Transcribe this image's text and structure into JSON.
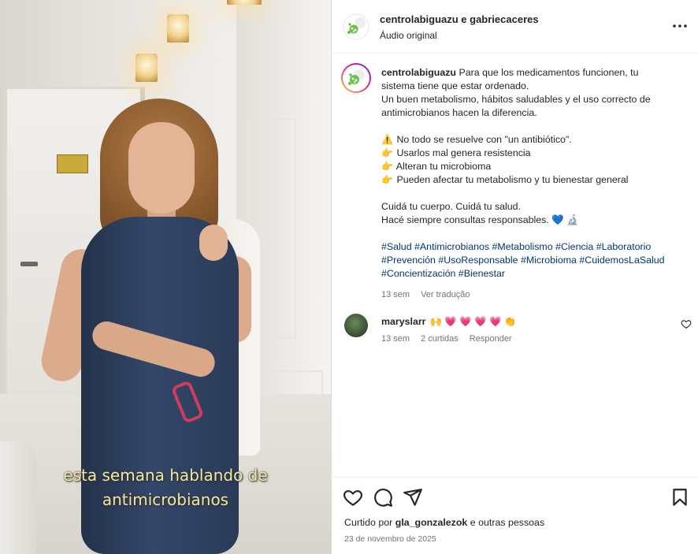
{
  "video": {
    "caption_line1": "esta semana hablando de",
    "caption_line2": "antimicrobianos"
  },
  "header": {
    "accounts": "centrolabiguazu e gabriecaceres",
    "audio": "Áudio original",
    "more_icon": "more-horizontal-icon"
  },
  "post": {
    "username": "centrolabiguazu",
    "lines": [
      "Para que los medicamentos funcionen, tu",
      "sistema tiene que estar ordenado.",
      "Un buen metabolismo, hábitos saludables y el uso correcto de",
      "antimicrobianos hacen la diferencia."
    ],
    "bullets": [
      {
        "emoji": "⚠️",
        "text": "No todo se resuelve con \"un antibiótico\"."
      },
      {
        "emoji": "👉",
        "text": "Usarlos mal genera resistencia"
      },
      {
        "emoji": "👉",
        "text": "Alteran tu microbioma"
      },
      {
        "emoji": "👉",
        "text": "Pueden afectar tu metabolismo y tu bienestar general"
      }
    ],
    "closing1": "Cuidá tu cuerpo. Cuidá tu salud.",
    "closing2": "Hacé siempre consultas responsables. 💙 🔬",
    "hashtags1": "#Salud #Antimicrobianos #Metabolismo #Ciencia #Laboratorio",
    "hashtags2": "#Prevención #UsoResponsable #Microbioma #CuidemosLaSalud",
    "hashtags3": "#Concientización #Bienestar",
    "time": "13 sem",
    "translate": "Ver tradução"
  },
  "comment": {
    "username": "maryslarr",
    "text": "🙌 💗 💗 💗 💗 👏",
    "time": "13 sem",
    "likes": "2 curtidas",
    "reply": "Responder"
  },
  "actions": {
    "liked_prefix": "Curtido por",
    "liked_user": "gla_gonzalezok",
    "liked_suffix": "e outras pessoas",
    "date": "23 de novembro de 2025"
  },
  "colors": {
    "hashtag": "#00376b",
    "muted": "#737373",
    "text": "#262626",
    "logo_green": "#6cc04a"
  }
}
